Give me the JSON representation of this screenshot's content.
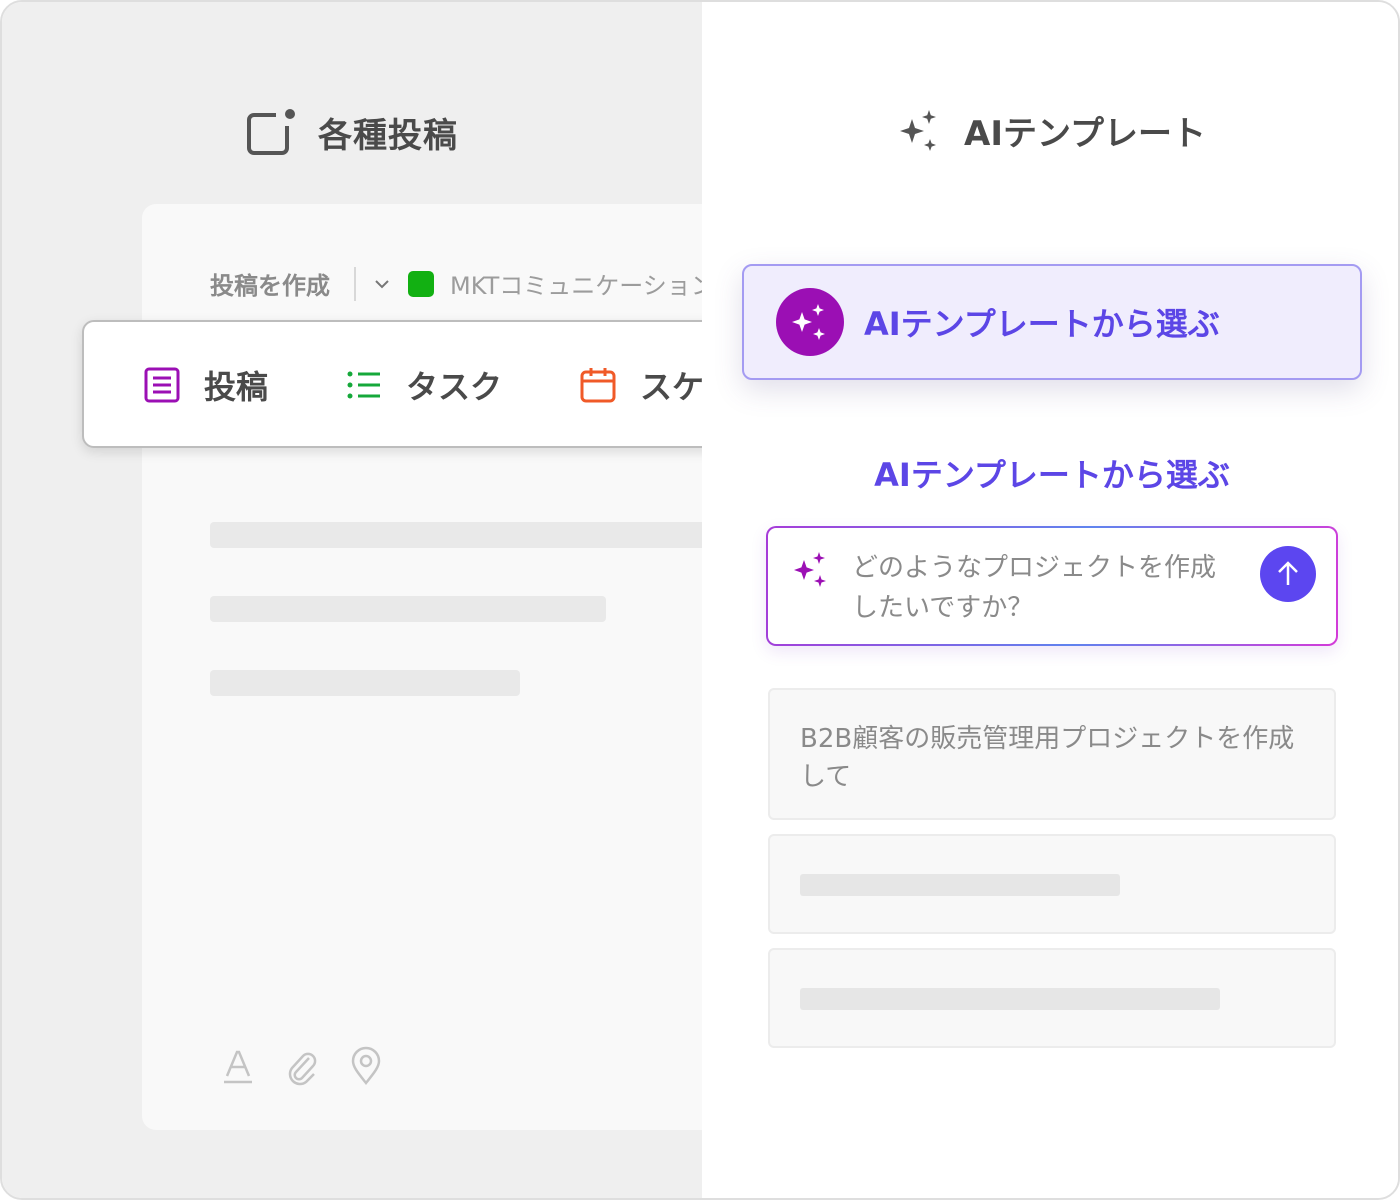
{
  "left_panel": {
    "title": "各種投稿",
    "create_label": "投稿を作成",
    "project_name": "MKTコミュニケーション",
    "project_color": "#12b012",
    "toolbar": {
      "items": [
        {
          "label": "投稿",
          "icon": "post-icon",
          "color": "#9b0fb4"
        },
        {
          "label": "タスク",
          "icon": "task-list-icon",
          "color": "#15a83a"
        },
        {
          "label": "スケジュール",
          "icon": "calendar-icon",
          "color": "#f05a28"
        }
      ]
    },
    "bottom_tools": [
      "text-format-icon",
      "attachment-icon",
      "location-icon"
    ]
  },
  "right_panel": {
    "title": "AIテンプレート",
    "select_button_label": "AIテンプレートから選ぶ",
    "section_title": "AIテンプレートから選ぶ",
    "prompt": {
      "placeholder": "どのようなプロジェクトを作成したいですか？"
    },
    "suggestions": [
      {
        "text": "B2B顧客の販売管理用プロジェクトを作成して"
      }
    ],
    "accent_color": "#5c46e6",
    "badge_color": "#9b0fb4"
  }
}
